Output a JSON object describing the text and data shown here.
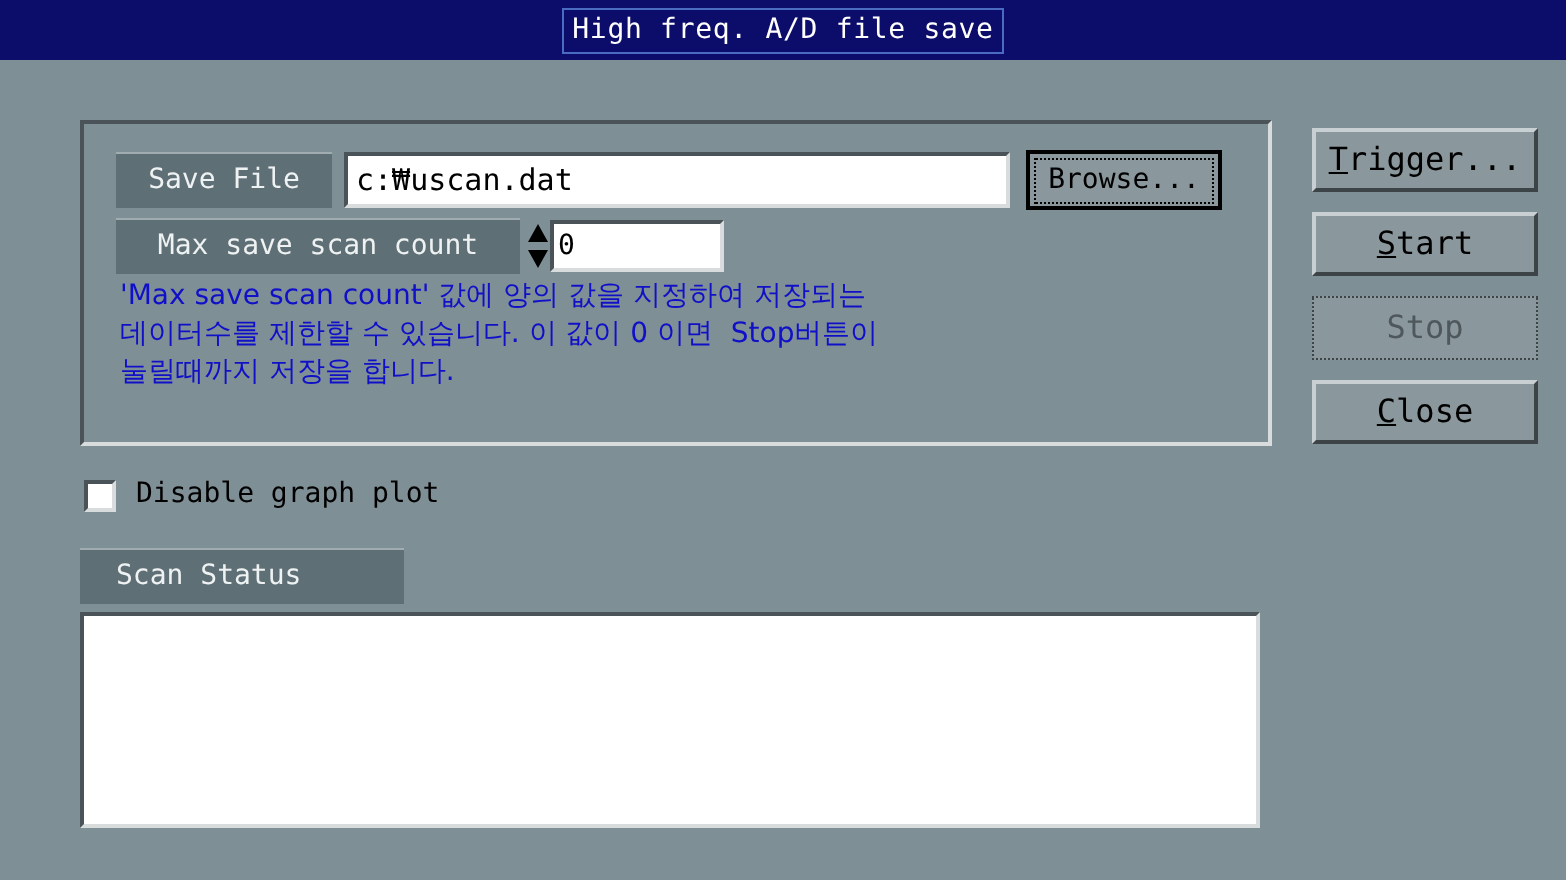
{
  "window": {
    "title": "High freq. A/D file save"
  },
  "save_file": {
    "label": "Save File",
    "value": "c:₩uscan.dat",
    "browse": {
      "label": "Browse...",
      "focused": true
    }
  },
  "max_scan": {
    "label": "Max save scan count",
    "value": "0"
  },
  "description": "'Max save scan count' 값에 양의 값을 지정하여 저장되는\n데이터수를 제한할 수 있습니다. 이 값이 0 이면  Stop버튼이\n눌릴때까지 저장을 합니다.",
  "buttons": [
    {
      "hotkey": "T",
      "label_rest": "rigger...",
      "disabled": false
    },
    {
      "hotkey": "S",
      "label_rest": "tart",
      "disabled": false
    },
    {
      "label_rest": "Stop",
      "disabled": true
    },
    {
      "hotkey": "C",
      "label_rest": "lose",
      "disabled": false
    }
  ],
  "disable_graph_plot": {
    "label": "Disable graph plot",
    "checked": false
  },
  "scan_status": {
    "label": "Scan Status"
  }
}
